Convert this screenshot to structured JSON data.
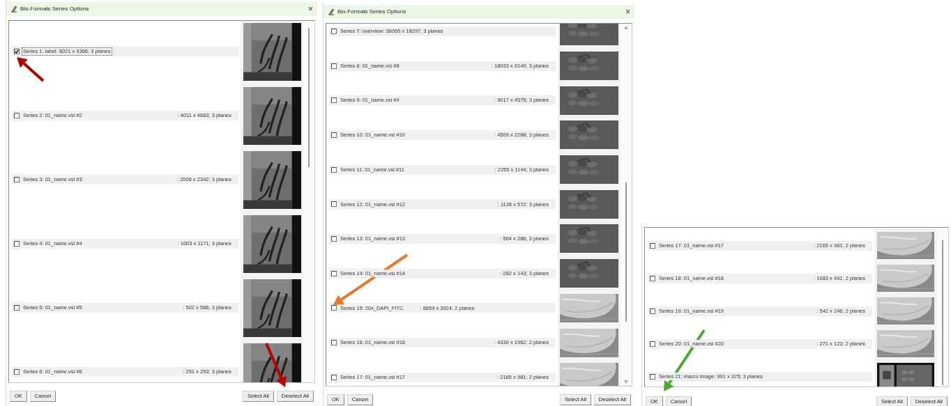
{
  "panels": [
    {
      "title": "Bio-Formats Series Options",
      "close": "×",
      "series": [
        {
          "kind": "single",
          "label": "Series 1: label: 8021 x 9366; 3 planes",
          "checked": true,
          "focused": true,
          "thumbnail": {
            "kind": "label"
          }
        },
        {
          "kind": "split",
          "label": "Series 2: 01_name.vsi #2",
          "dims": ": 4011 x 4683; 3 planes",
          "checked": false,
          "focused": false,
          "thumbnail": {
            "kind": "label"
          }
        },
        {
          "kind": "split",
          "label": "Series 3: 01_name.vsi #3",
          "dims": ": 2006 x 2342; 3 planes",
          "checked": false,
          "focused": false,
          "thumbnail": {
            "kind": "label"
          }
        },
        {
          "kind": "split",
          "label": "Series 4: 01_name.vsi #4",
          "dims": ": 1003 x 1171; 3 planes",
          "checked": false,
          "focused": false,
          "thumbnail": {
            "kind": "label"
          }
        },
        {
          "kind": "split",
          "label": "Series 5: 01_name.vsi #5",
          "dims": ": 502 x 586; 3 planes",
          "checked": false,
          "focused": false,
          "thumbnail": {
            "kind": "label"
          }
        },
        {
          "kind": "split",
          "label": "Series 6: 01_name.vsi #6",
          "dims": ": 251 x 293; 3 planes",
          "checked": false,
          "focused": false,
          "thumbnail": {
            "kind": "label"
          }
        }
      ],
      "buttons_left": [
        "OK",
        "Cancel"
      ],
      "buttons_right": [
        "Select All",
        "Deselect All"
      ]
    },
    {
      "title": "Bio-Formats Series Options",
      "close": "×",
      "series": [
        {
          "kind": "single",
          "label": "Series 7: overview: 36065 x 18297; 3 planes",
          "checked": false,
          "focused": false,
          "thumbnail": {
            "kind": "overview"
          }
        },
        {
          "kind": "split",
          "label": "Series 8: 01_name.vsi #8",
          "dims": ": 18033 x 9149; 3 planes",
          "checked": false,
          "focused": false,
          "thumbnail": {
            "kind": "overview"
          }
        },
        {
          "kind": "split",
          "label": "Series 9: 01_name.vsi #9",
          "dims": ": 9017 x 4575; 3 planes",
          "checked": false,
          "focused": false,
          "thumbnail": {
            "kind": "overview"
          }
        },
        {
          "kind": "split",
          "label": "Series 10: 01_name.vsi #10",
          "dims": ": 4509 x 2288; 3 planes",
          "checked": false,
          "focused": false,
          "thumbnail": {
            "kind": "overview"
          }
        },
        {
          "kind": "split",
          "label": "Series 11: 01_name.vsi #11",
          "dims": ": 2255 x 1144; 3 planes",
          "checked": false,
          "focused": false,
          "thumbnail": {
            "kind": "overview"
          }
        },
        {
          "kind": "split",
          "label": "Series 12: 01_name.vsi #12",
          "dims": ": 1128 x 572; 3 planes",
          "checked": false,
          "focused": false,
          "thumbnail": {
            "kind": "overview"
          }
        },
        {
          "kind": "split",
          "label": "Series 13: 01_name.vsi #13",
          "dims": ": 564 x 286; 3 planes",
          "checked": false,
          "focused": false,
          "thumbnail": {
            "kind": "overview"
          }
        },
        {
          "kind": "split",
          "label": "Series 14: 01_name.vsi #14",
          "dims": ": 282 x 143; 3 planes",
          "checked": false,
          "focused": false,
          "thumbnail": {
            "kind": "overview"
          }
        },
        {
          "kind": "inline",
          "label": "Series 15: 20x_DAPI_FITC",
          "dims": ": 8659 x 3924; 2 planes",
          "checked": false,
          "focused": false,
          "thumbnail": {
            "kind": "tissue"
          }
        },
        {
          "kind": "split",
          "label": "Series 16: 01_name.vsi #16",
          "dims": ": 4330 x 1962; 2 planes",
          "checked": false,
          "focused": false,
          "thumbnail": {
            "kind": "tissue"
          }
        },
        {
          "kind": "split",
          "label": "Series 17: 01_name.vsi #17",
          "dims": ": 2165 x 981; 2 planes",
          "checked": false,
          "focused": false,
          "thumbnail": {
            "kind": "tissue"
          }
        }
      ],
      "buttons_left": [
        "OK",
        "Cancel"
      ],
      "buttons_right": [
        "Select All",
        "Deselect All"
      ]
    },
    {
      "series": [
        {
          "kind": "split",
          "label": "Series 17: 01_name.vsi #17",
          "dims": ": 2165 x 981; 2 planes",
          "checked": false,
          "focused": false,
          "thumbnail": {
            "kind": "tissue"
          }
        },
        {
          "kind": "split",
          "label": "Series 18: 01_name.vsi #18",
          "dims": ": 1083 x 491; 2 planes",
          "checked": false,
          "focused": false,
          "thumbnail": {
            "kind": "tissue"
          }
        },
        {
          "kind": "split",
          "label": "Series 19: 01_name.vsi #19",
          "dims": ": 542 x 246; 2 planes",
          "checked": false,
          "focused": false,
          "thumbnail": {
            "kind": "tissue"
          }
        },
        {
          "kind": "split",
          "label": "Series 20: 01_name.vsi #20",
          "dims": ": 271 x 123; 2 planes",
          "checked": false,
          "focused": false,
          "thumbnail": {
            "kind": "tissue"
          }
        },
        {
          "kind": "single",
          "label": "Series 21: macro image: 991 x 375; 3 planes",
          "checked": false,
          "focused": false,
          "thumbnail": {
            "kind": "macro"
          }
        }
      ],
      "buttons_left": [
        "OK",
        "Cancel"
      ],
      "buttons_right": [
        "Select All",
        "Deselect All"
      ]
    }
  ]
}
